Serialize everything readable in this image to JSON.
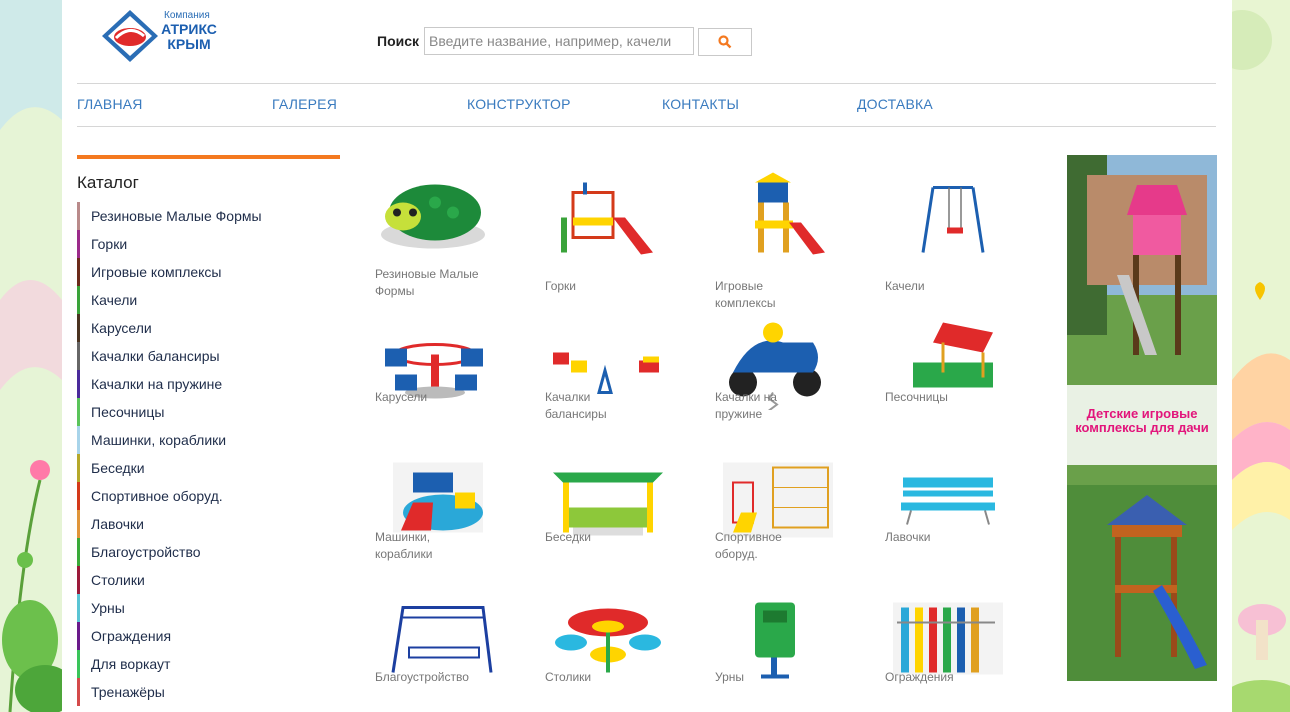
{
  "logo": {
    "top_text": "Компания",
    "name": "АТРИКС КРЫМ"
  },
  "search": {
    "label": "Поиск",
    "placeholder": "Введите название, например, качели"
  },
  "nav": {
    "items": [
      "ГЛАВНАЯ",
      "ГАЛЕРЕЯ",
      "КОНСТРУКТОР",
      "КОНТАКТЫ",
      "ДОСТАВКА"
    ]
  },
  "sidebar": {
    "title": "Каталог",
    "items": [
      {
        "label": "Резиновые Малые Формы",
        "color": "#b98a8a"
      },
      {
        "label": "Горки",
        "color": "#9b2a8a"
      },
      {
        "label": "Игровые комплексы",
        "color": "#6b2a1a"
      },
      {
        "label": "Качели",
        "color": "#3aa33a"
      },
      {
        "label": "Карусели",
        "color": "#4a3320"
      },
      {
        "label": "Качалки балансиры",
        "color": "#666666"
      },
      {
        "label": "Качалки на пружине",
        "color": "#4a2a9b"
      },
      {
        "label": "Песочницы",
        "color": "#5ac45a"
      },
      {
        "label": "Машинки, кораблики",
        "color": "#a8d4ea"
      },
      {
        "label": "Беседки",
        "color": "#b5a82a"
      },
      {
        "label": "Спортивное оборуд.",
        "color": "#d43a1a"
      },
      {
        "label": "Лавочки",
        "color": "#e0953a"
      },
      {
        "label": "Благоустройство",
        "color": "#3aaa3a"
      },
      {
        "label": "Столики",
        "color": "#9b1a3a"
      },
      {
        "label": "Урны",
        "color": "#5ac4d4"
      },
      {
        "label": "Ограждения",
        "color": "#6a1a8a"
      },
      {
        "label": "Для воркаут",
        "color": "#3ac45a"
      },
      {
        "label": "Тренажёры",
        "color": "#d44a4a"
      }
    ]
  },
  "catalog": {
    "items": [
      {
        "label": "Резиновые Малые Формы",
        "icon": "rubber-turtle"
      },
      {
        "label": "Горки",
        "icon": "slide"
      },
      {
        "label": "Игровые комплексы",
        "icon": "play-complex"
      },
      {
        "label": "Качели",
        "icon": "swing"
      },
      {
        "label": "Карусели",
        "icon": "carousel"
      },
      {
        "label": "Качалки балансиры",
        "icon": "seesaw"
      },
      {
        "label": "Качалки на пружине",
        "icon": "spring-rocker"
      },
      {
        "label": "Песочницы",
        "icon": "sandbox"
      },
      {
        "label": "Машинки, кораблики",
        "icon": "ship"
      },
      {
        "label": "Беседки",
        "icon": "gazebo"
      },
      {
        "label": "Спортивное оборуд.",
        "icon": "sport"
      },
      {
        "label": "Лавочки",
        "icon": "bench"
      },
      {
        "label": "Благоустройство",
        "icon": "frame"
      },
      {
        "label": "Столики",
        "icon": "table"
      },
      {
        "label": "Урны",
        "icon": "bin"
      },
      {
        "label": "Ограждения",
        "icon": "fence"
      }
    ]
  },
  "banner": {
    "text": "Детские игровые комплексы для дачи"
  }
}
